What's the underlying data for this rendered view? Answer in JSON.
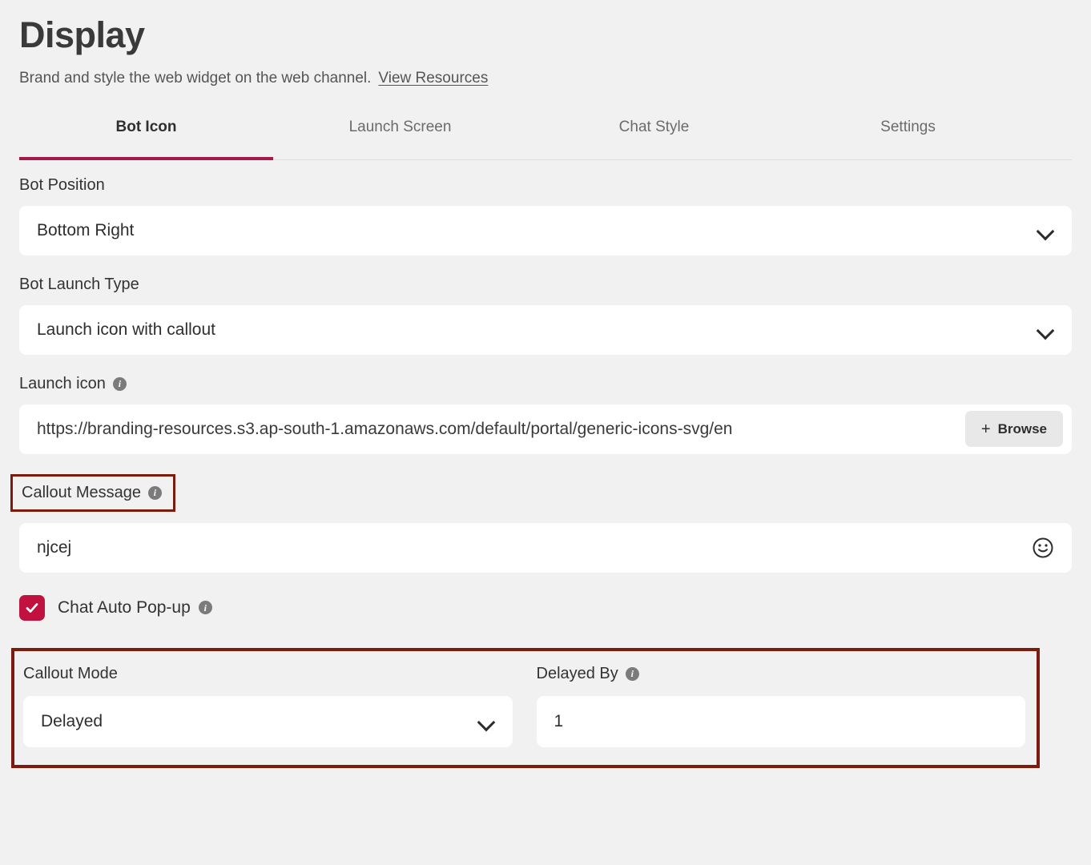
{
  "header": {
    "title": "Display",
    "subtitle": "Brand and style the web widget on the web channel.",
    "link_label": "View Resources"
  },
  "tabs": [
    {
      "label": "Bot Icon",
      "active": true
    },
    {
      "label": "Launch Screen",
      "active": false
    },
    {
      "label": "Chat Style",
      "active": false
    },
    {
      "label": "Settings",
      "active": false
    }
  ],
  "fields": {
    "bot_position": {
      "label": "Bot Position",
      "value": "Bottom Right",
      "chevron_icon": "chevron-down-icon"
    },
    "bot_launch_type": {
      "label": "Bot Launch Type",
      "value": "Launch icon with callout",
      "chevron_icon": "chevron-down-icon"
    },
    "launch_icon": {
      "label": "Launch icon",
      "info_icon": "info-icon",
      "value": "https://branding-resources.s3.ap-south-1.amazonaws.com/default/portal/generic-icons-svg/en",
      "browse_label": "Browse",
      "plus_icon": "plus-icon"
    },
    "callout_message": {
      "label": "Callout Message",
      "info_icon": "info-icon",
      "value": "njcej",
      "emoji_icon": "smiley-face-icon",
      "highlighted": true
    },
    "chat_auto_popup": {
      "label": "Chat Auto Pop-up",
      "info_icon": "info-icon",
      "checked": true,
      "check_icon": "checkmark-icon"
    },
    "callout_mode": {
      "label": "Callout Mode",
      "value": "Delayed",
      "chevron_icon": "chevron-down-icon"
    },
    "delayed_by": {
      "label": "Delayed By",
      "info_icon": "info-icon",
      "value": "1"
    }
  },
  "colors": {
    "page_background": "#f2f1f1",
    "accent": "#a3194a",
    "checkbox": "#c0113f",
    "highlight_border": "#7d1c0c",
    "field_background": "#ffffff",
    "title_text": "#3a3a3a"
  }
}
